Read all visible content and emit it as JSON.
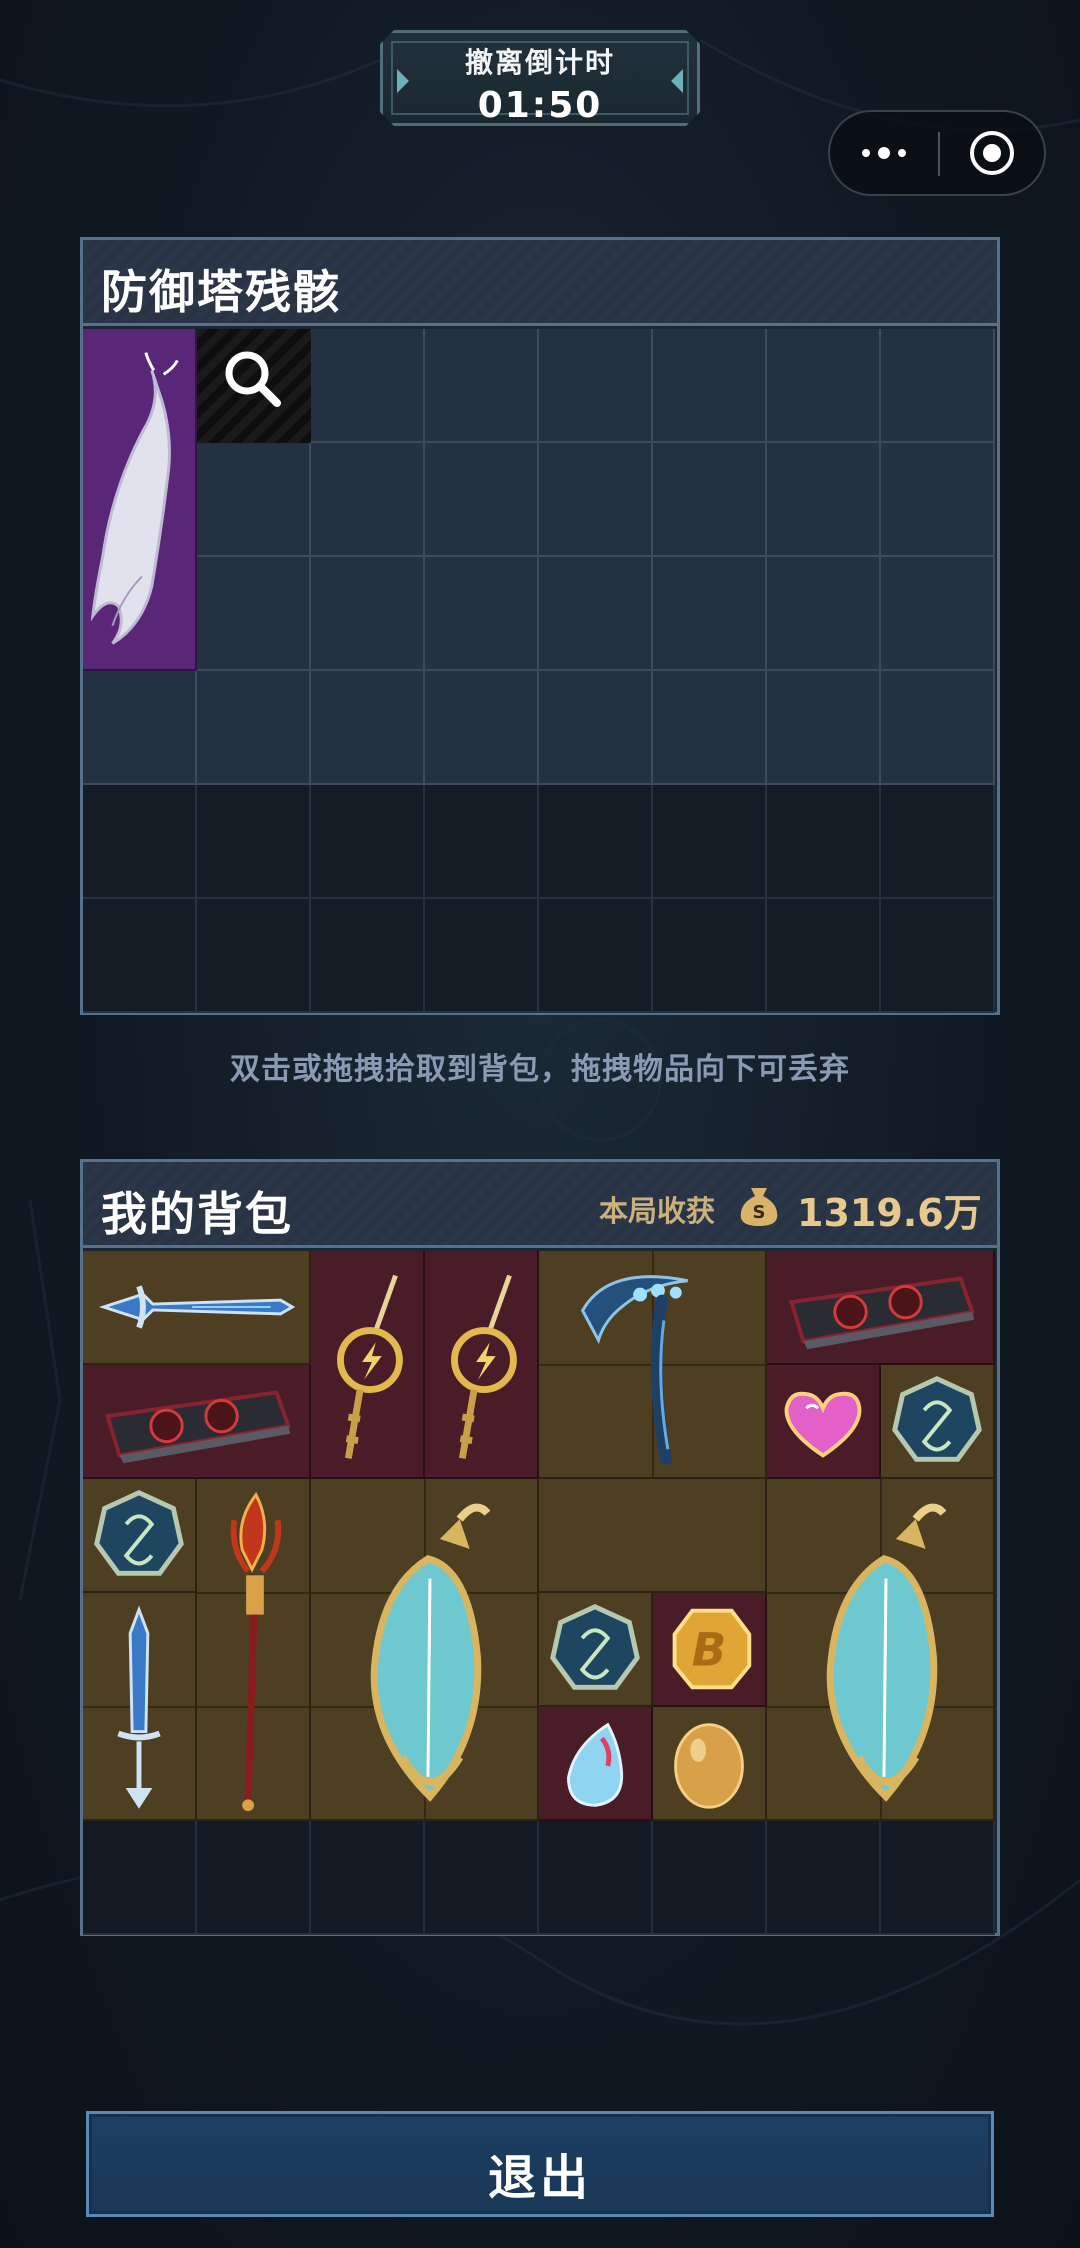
{
  "countdown": {
    "label": "撤离倒计时",
    "time": "01:50"
  },
  "capsule": {
    "more_icon": "more-dots-icon",
    "close_icon": "target-close-icon"
  },
  "loot_panel": {
    "title": "防御塔残骸",
    "columns": 8,
    "rows": 6,
    "items": [
      {
        "name": "white-spirit-fish",
        "rarity_color": "#5a2678"
      }
    ],
    "search_icon": "magnifier-icon"
  },
  "hint": "双击或拖拽拾取到背包，拖拽物品向下可丢弃",
  "backpack": {
    "title": "我的背包",
    "earnings_label": "本局收获",
    "earnings_value": "1319.6万",
    "earnings_icon": "money-bag-icon",
    "columns": 8,
    "rows": 6,
    "items": [
      {
        "name": "blue-dagger",
        "rarity_color": "#4e3f22"
      },
      {
        "name": "golden-lightning-key",
        "rarity_color": "#4a1c28"
      },
      {
        "name": "golden-lightning-key",
        "rarity_color": "#4a1c28"
      },
      {
        "name": "blue-scythe",
        "rarity_color": "#4e3f22"
      },
      {
        "name": "graphics-card",
        "rarity_color": "#4a1c28"
      },
      {
        "name": "graphics-card",
        "rarity_color": "#4a1c28"
      },
      {
        "name": "pink-heart-gem",
        "rarity_color": "#4a1c28"
      },
      {
        "name": "blue-amulet",
        "rarity_color": "#4e3f22"
      },
      {
        "name": "blue-amulet",
        "rarity_color": "#4e3f22"
      },
      {
        "name": "red-trident-staff",
        "rarity_color": "#4e3f22"
      },
      {
        "name": "jade-lute",
        "rarity_color": "#4e3f22"
      },
      {
        "name": "blue-amulet",
        "rarity_color": "#4e3f22"
      },
      {
        "name": "gold-bitcoin",
        "rarity_color": "#4a1c28"
      },
      {
        "name": "blue-dagger-vertical",
        "rarity_color": "#4e3f22"
      },
      {
        "name": "crystal-teardrop",
        "rarity_color": "#4a1c28"
      },
      {
        "name": "golden-egg",
        "rarity_color": "#4e3f22"
      },
      {
        "name": "jade-lute",
        "rarity_color": "#4e3f22"
      }
    ]
  },
  "exit_button": {
    "label": "退出"
  },
  "colors": {
    "panel_border": "#56718e",
    "item_brown": "#4e3f22",
    "item_red": "#4a1c28",
    "item_purple": "#5a2678",
    "exit_button": "#1c3f63"
  }
}
